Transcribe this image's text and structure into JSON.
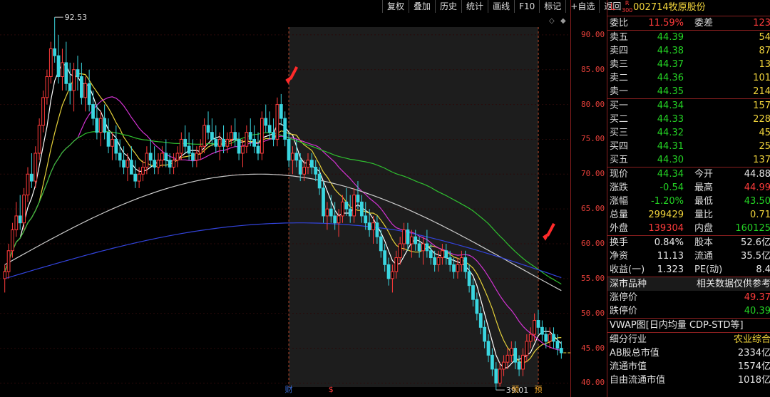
{
  "toolbar": [
    "复权",
    "叠加",
    "历史",
    "统计",
    "画线",
    "F10",
    "标记",
    "+自选",
    "返回"
  ],
  "axis": {
    "ticks": [
      "90.00",
      "85.00",
      "80.00",
      "75.00",
      "70.00",
      "65.00",
      "60.00",
      "55.00",
      "50.00",
      "45.00",
      "40.00"
    ]
  },
  "chart_labels": {
    "high": "92.53",
    "low": "39.01"
  },
  "bottom_markers": [
    "财",
    "$",
    "预",
    "预"
  ],
  "stock": {
    "flag": "L",
    "rz": "R",
    "rz_num": "300",
    "code": "002714",
    "name": "牧原股份"
  },
  "weibi": {
    "label": "委比",
    "value": "11.59%",
    "label2": "委差",
    "value2": "123"
  },
  "asks": [
    {
      "label": "卖五",
      "price": "44.39",
      "vol": "54"
    },
    {
      "label": "卖四",
      "price": "44.38",
      "vol": "87"
    },
    {
      "label": "卖三",
      "price": "44.37",
      "vol": "13"
    },
    {
      "label": "卖二",
      "price": "44.36",
      "vol": "101"
    },
    {
      "label": "卖一",
      "price": "44.35",
      "vol": "214"
    }
  ],
  "bids": [
    {
      "label": "买一",
      "price": "44.34",
      "vol": "157"
    },
    {
      "label": "买二",
      "price": "44.33",
      "vol": "228"
    },
    {
      "label": "买三",
      "price": "44.32",
      "vol": "45"
    },
    {
      "label": "买四",
      "price": "44.31",
      "vol": "25"
    },
    {
      "label": "买五",
      "price": "44.30",
      "vol": "137"
    }
  ],
  "quote": [
    {
      "l1": "现价",
      "v1": "44.34",
      "c1": "green",
      "l2": "今开",
      "v2": "44.88",
      "c2": "white"
    },
    {
      "l1": "涨跌",
      "v1": "-0.54",
      "c1": "green",
      "l2": "最高",
      "v2": "44.99",
      "c2": "red"
    },
    {
      "l1": "涨幅",
      "v1": "-1.20%",
      "c1": "green",
      "l2": "最低",
      "v2": "43.50",
      "c2": "green"
    },
    {
      "l1": "总量",
      "v1": "299429",
      "c1": "yellow",
      "l2": "量比",
      "v2": "0.71",
      "c2": "yellow"
    },
    {
      "l1": "外盘",
      "v1": "139304",
      "c1": "red",
      "l2": "内盘",
      "v2": "160125",
      "c2": "green"
    }
  ],
  "fund": [
    {
      "l1": "换手",
      "v1": "0.84%",
      "l2": "股本",
      "v2": "52.6亿"
    },
    {
      "l1": "净资",
      "v1": "11.13",
      "l2": "流通",
      "v2": "35.5亿"
    },
    {
      "l1": "收益(一)",
      "v1": "1.323",
      "l2": "PE(动)",
      "v2": "8.4"
    }
  ],
  "market": {
    "label": "深市品种",
    "note": "相关数据仅供参考"
  },
  "limits": [
    {
      "label": "涨停价",
      "value": "49.37",
      "color": "red"
    },
    {
      "label": "跌停价",
      "value": "40.39",
      "color": "green"
    }
  ],
  "vwap": "VWAP图[日内均量 CDP-STD等]",
  "industry": {
    "label": "细分行业",
    "value": "农业综合"
  },
  "caps": [
    {
      "label": "AB股总市值",
      "value": "2334亿"
    },
    {
      "label": "流通市值",
      "value": "1574亿"
    },
    {
      "label": "自由流通市值",
      "value": "1018亿"
    }
  ],
  "chart_data": {
    "type": "candlestick",
    "ylim": [
      38,
      95
    ],
    "highlight_range_days": [
      74,
      139
    ],
    "candles": [
      [
        55,
        57,
        53,
        56
      ],
      [
        56,
        60,
        55,
        59
      ],
      [
        59,
        63,
        58,
        62
      ],
      [
        62,
        66,
        61,
        64
      ],
      [
        64,
        67,
        62,
        63
      ],
      [
        63,
        68,
        62,
        67
      ],
      [
        67,
        71,
        66,
        70
      ],
      [
        70,
        73,
        68,
        69
      ],
      [
        69,
        74,
        68,
        73
      ],
      [
        73,
        78,
        72,
        77
      ],
      [
        77,
        82,
        76,
        81
      ],
      [
        81,
        85,
        80,
        84
      ],
      [
        84,
        89,
        83,
        88
      ],
      [
        88,
        92.53,
        86,
        87
      ],
      [
        87,
        90,
        83,
        84
      ],
      [
        84,
        88,
        82,
        86
      ],
      [
        86,
        89,
        82,
        83
      ],
      [
        83,
        86,
        80,
        82
      ],
      [
        82,
        86,
        79,
        85
      ],
      [
        85,
        87,
        82,
        84
      ],
      [
        84,
        86,
        80,
        81
      ],
      [
        81,
        84,
        79,
        83
      ],
      [
        83,
        85,
        79,
        80
      ],
      [
        80,
        82,
        77,
        78
      ],
      [
        78,
        80,
        75,
        76
      ],
      [
        76,
        79,
        74,
        78
      ],
      [
        78,
        80,
        75,
        76
      ],
      [
        76,
        78,
        73,
        74
      ],
      [
        74,
        76,
        72,
        75
      ],
      [
        75,
        77,
        72,
        73
      ],
      [
        73,
        75,
        71,
        72
      ],
      [
        72,
        74,
        70,
        71
      ],
      [
        71,
        73,
        69,
        72
      ],
      [
        72,
        74,
        70,
        70
      ],
      [
        70,
        72,
        68,
        69
      ],
      [
        69,
        71,
        68,
        70
      ],
      [
        70,
        72,
        69,
        71
      ],
      [
        71,
        74,
        70,
        73
      ],
      [
        73,
        75,
        71,
        72
      ],
      [
        72,
        74,
        70,
        71
      ],
      [
        71,
        73,
        70,
        72
      ],
      [
        72,
        74,
        71,
        73
      ],
      [
        73,
        75,
        71,
        72
      ],
      [
        72,
        73,
        70,
        71
      ],
      [
        71,
        73,
        70,
        72
      ],
      [
        72,
        74,
        71,
        73
      ],
      [
        73,
        76,
        72,
        75
      ],
      [
        75,
        77,
        73,
        74
      ],
      [
        74,
        76,
        72,
        73
      ],
      [
        73,
        75,
        71,
        72
      ],
      [
        72,
        74,
        71,
        73
      ],
      [
        73,
        75,
        72,
        74
      ],
      [
        74,
        78,
        73,
        77
      ],
      [
        77,
        79,
        75,
        76
      ],
      [
        76,
        78,
        74,
        75
      ],
      [
        75,
        77,
        73,
        74
      ],
      [
        74,
        76,
        72,
        75
      ],
      [
        75,
        77,
        73,
        74
      ],
      [
        74,
        76,
        73,
        75
      ],
      [
        75,
        77,
        74,
        76
      ],
      [
        76,
        78,
        74,
        75
      ],
      [
        75,
        76,
        72,
        73
      ],
      [
        73,
        75,
        71,
        74
      ],
      [
        74,
        77,
        73,
        76
      ],
      [
        76,
        78,
        74,
        75
      ],
      [
        75,
        77,
        73,
        74
      ],
      [
        74,
        76,
        72,
        73
      ],
      [
        73,
        79,
        72,
        78
      ],
      [
        78,
        80,
        76,
        77
      ],
      [
        77,
        79,
        75,
        76
      ],
      [
        76,
        78,
        74,
        75
      ],
      [
        75,
        81,
        74,
        80
      ],
      [
        80,
        81.5,
        77,
        78
      ],
      [
        78,
        79,
        74,
        75
      ],
      [
        75,
        76,
        71,
        72
      ],
      [
        72,
        74,
        70,
        73
      ],
      [
        73,
        75,
        71,
        72
      ],
      [
        72,
        73,
        69,
        70
      ],
      [
        70,
        72,
        69,
        71
      ],
      [
        71,
        73,
        70,
        72
      ],
      [
        72,
        73,
        70,
        71
      ],
      [
        71,
        72,
        69,
        70
      ],
      [
        70,
        71,
        67,
        68
      ],
      [
        68,
        69,
        63,
        64
      ],
      [
        64,
        66,
        62,
        65
      ],
      [
        65,
        67,
        63,
        64
      ],
      [
        64,
        66,
        62,
        63
      ],
      [
        63,
        65,
        61,
        64
      ],
      [
        64,
        67,
        63,
        66
      ],
      [
        66,
        68,
        64,
        65
      ],
      [
        65,
        67,
        63,
        64
      ],
      [
        64,
        68,
        63,
        67
      ],
      [
        67,
        69,
        65,
        66
      ],
      [
        66,
        67,
        63,
        64
      ],
      [
        64,
        66,
        62,
        63
      ],
      [
        63,
        65,
        61,
        62
      ],
      [
        62,
        64,
        60,
        63
      ],
      [
        63,
        64,
        60,
        61
      ],
      [
        61,
        62,
        58,
        59
      ],
      [
        59,
        60,
        56,
        57
      ],
      [
        57,
        58,
        54,
        55
      ],
      [
        55,
        57,
        53,
        56
      ],
      [
        56,
        59,
        55,
        58
      ],
      [
        58,
        61,
        57,
        60
      ],
      [
        60,
        63,
        59,
        62
      ],
      [
        62,
        63,
        59,
        60
      ],
      [
        60,
        62,
        58,
        61
      ],
      [
        61,
        62,
        59,
        60
      ],
      [
        60,
        61,
        58,
        59
      ],
      [
        59,
        61,
        57,
        60
      ],
      [
        60,
        62,
        58,
        59
      ],
      [
        59,
        60,
        57,
        58
      ],
      [
        58,
        59,
        56,
        57
      ],
      [
        57,
        59,
        56,
        58
      ],
      [
        58,
        60,
        57,
        59
      ],
      [
        59,
        60,
        57,
        58
      ],
      [
        58,
        59,
        56,
        57
      ],
      [
        57,
        58,
        55,
        56
      ],
      [
        56,
        58,
        55,
        57
      ],
      [
        57,
        59,
        56,
        58
      ],
      [
        58,
        59,
        55,
        56
      ],
      [
        56,
        57,
        53,
        54
      ],
      [
        54,
        55,
        51,
        52
      ],
      [
        52,
        53,
        49,
        50
      ],
      [
        50,
        51,
        47,
        48
      ],
      [
        48,
        49,
        45,
        46
      ],
      [
        46,
        47,
        43,
        44
      ],
      [
        44,
        45,
        41,
        42
      ],
      [
        42,
        43,
        39.01,
        40
      ],
      [
        40,
        43,
        39.5,
        42
      ],
      [
        42,
        44,
        41,
        43
      ],
      [
        43,
        45,
        42,
        44
      ],
      [
        44,
        46,
        43,
        45
      ],
      [
        45,
        46,
        42,
        43
      ],
      [
        43,
        44,
        41,
        42
      ],
      [
        42,
        45,
        41,
        44
      ],
      [
        44,
        47,
        43,
        46
      ],
      [
        46,
        48,
        45,
        47
      ],
      [
        47,
        50,
        46,
        49
      ],
      [
        49,
        50.5,
        47,
        48
      ],
      [
        48,
        49,
        46,
        47
      ],
      [
        47,
        48,
        45,
        46
      ],
      [
        46,
        48,
        45,
        47
      ],
      [
        47,
        48,
        45,
        46
      ],
      [
        46,
        47,
        44,
        45
      ],
      [
        45,
        46,
        43.5,
        44.34
      ]
    ]
  }
}
